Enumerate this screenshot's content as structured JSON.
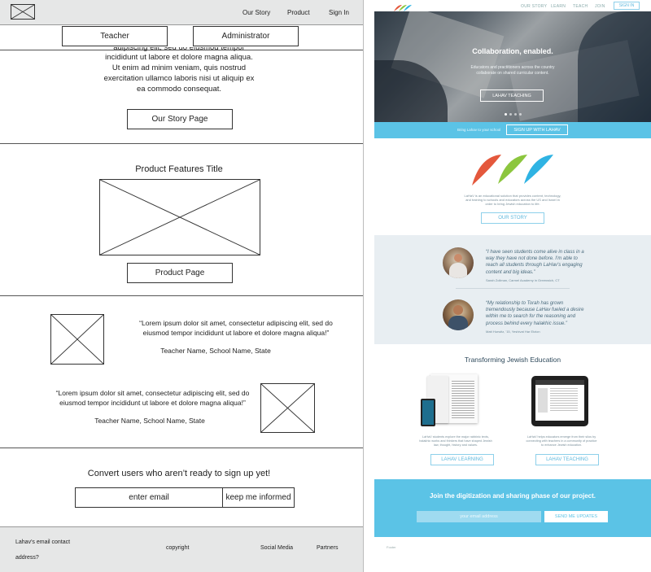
{
  "wireframe": {
    "nav": {
      "our_story": "Our Story",
      "product": "Product",
      "sign_in": "Sign In"
    },
    "roles": {
      "teacher": "Teacher",
      "administrator": "Administrator"
    },
    "lorem_lines": [
      "adipiscing elit, sed do eiusmod tempor",
      "incididunt ut labore et dolore magna aliqua.",
      "Ut enim ad minim veniam, quis nostrud",
      "exercitation ullamco laboris nisi ut aliquip ex",
      "ea commodo consequat."
    ],
    "our_story_button": "Our Story Page",
    "product_title": "Product Features Title",
    "product_button": "Product Page",
    "quote1_lines": [
      "“Lorem ipsum dolor sit amet, consectetur adipiscing elit, sed do",
      "eiusmod tempor incididunt ut labore et dolore magna aliqua!”"
    ],
    "quote1_name": "Teacher Name, School Name, State",
    "quote2_lines": [
      "“Lorem ipsum dolor sit amet, consectetur adipiscing elit, sed do",
      "eiusmod tempor incididunt ut labore et dolore magna aliqua!”"
    ],
    "quote2_name": "Teacher Name, School Name, State",
    "convert_title": "Convert users who aren’t ready to sign up yet!",
    "email_placeholder": "enter email",
    "keep_informed": "keep me informed",
    "footer": {
      "contact_line1": "Lahav's email contact",
      "contact_line2": "address?",
      "copyright": "copyright",
      "social": "Social Media",
      "partners": "Partners"
    }
  },
  "mock": {
    "nav": {
      "our_story": "OUR STORY",
      "learn": "LEARN",
      "teach": "TEACH",
      "join": "JOIN",
      "sign_in": "SIGN IN"
    },
    "hero": {
      "title": "Collaboration, enabled.",
      "subtitle_lines": [
        "Educators and practitioners across the country",
        "collaborate on shared curricular content."
      ],
      "button": "LAHAV TEACHING"
    },
    "signup_bar": {
      "label": "Bring Lahav to your school",
      "button": "SIGN UP WITH LAHAV"
    },
    "about_lines": [
      "LaHaV is an educational solution that provides content, technology,",
      "and training to schools and educators across the US and Israel in",
      "order to bring Jewish education to life."
    ],
    "our_story_button": "OUR STORY",
    "testimonials": [
      {
        "lines": [
          "“I have seen students come alive in class in a",
          "way they have not done before. I'm able to",
          "reach all students through LaHav's engaging",
          "content and big ideas.”"
        ],
        "name": "Sarah Zollman, Carmel Academy in Greenwich, CT"
      },
      {
        "lines": [
          "“My relationship to Torah has grown",
          "tremendously because LaHav fueled a desire",
          "within me to search for the reasoning and",
          "process behind every halakhic issue.”"
        ],
        "name": "Matt Hurwitz, '15, Yeshivat Har Etzion"
      }
    ],
    "transform_title": "Transforming Jewish Education",
    "learning_lines": [
      "LaHaV students explore the major rabbinic texts,",
      "halakhic works and thinkers that have shaped Jewish",
      "law, thought, history and values."
    ],
    "teaching_lines": [
      "LaHaV helps educators emerge from their silos by",
      "connecting with teachers in a community of practice",
      "to enhance Jewish education."
    ],
    "learning_button": "LAHAV LEARNING",
    "teaching_button": "LAHAV TEACHING",
    "join": {
      "title": "Join the digitization and sharing phase of our project.",
      "placeholder": "your email address",
      "button": "SEND ME UPDATES"
    },
    "footer_text": "Footer",
    "colors": {
      "accent": "#5bc3e6",
      "red": "#e4583c",
      "green": "#8cc63e",
      "blue": "#2fb3e3",
      "panel": "#e8eef2"
    }
  }
}
